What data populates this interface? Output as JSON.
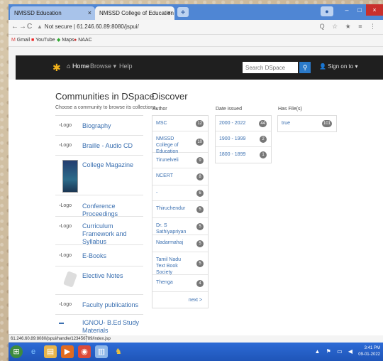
{
  "browser": {
    "tabs": [
      {
        "label": "NMSSD Education"
      },
      {
        "label": "NMSSD College of Education Pr"
      }
    ],
    "address": "Not secure | 61.246.60.89:8080/jspui/",
    "bookmarks": [
      "Gmail",
      "YouTube",
      "Maps",
      "NAAC"
    ]
  },
  "navbar": {
    "home": "Home",
    "browse": "Browse",
    "help": "Help",
    "search_placeholder": "Search DSpace",
    "login": "Sign on to"
  },
  "communities": {
    "title": "Communities in DSpace",
    "subtitle": "Choose a community to browse its collections.",
    "items": [
      {
        "logo": "Logo",
        "name": "Biography"
      },
      {
        "logo": "Logo",
        "name": "Braille - Audio CD"
      },
      {
        "logo": "",
        "name": "College Magazine"
      },
      {
        "logo": "Logo",
        "name": "Conference Proceedings"
      },
      {
        "logo": "Logo",
        "name": "Curriculum Framework and Syllabus"
      },
      {
        "logo": "Logo",
        "name": "E-Books"
      },
      {
        "logo": "",
        "name": "Elective Notes"
      },
      {
        "logo": "Logo",
        "name": "Faculty publications"
      },
      {
        "logo": "",
        "name": "IGNOU- B.Ed Study Materials"
      }
    ]
  },
  "discover": {
    "title": "Discover",
    "author": {
      "label": "Author",
      "items": [
        {
          "name": "MSC",
          "count": "12"
        },
        {
          "name": "NMSSD College of Education",
          "count": "10"
        },
        {
          "name": "Tirunelveli",
          "count": "9"
        },
        {
          "name": "NCERT",
          "count": "8"
        },
        {
          "name": "-",
          "count": "6"
        },
        {
          "name": "Thiruchendur",
          "count": "5"
        },
        {
          "name": "Dr. S Sathiyapriyan",
          "count": "5"
        },
        {
          "name": "Nadarmahaj",
          "count": "5"
        },
        {
          "name": "Tamil Nadu Text Book Society",
          "count": "5"
        },
        {
          "name": "Thenga",
          "count": "4"
        }
      ],
      "more": "next >"
    },
    "date": {
      "label": "Date issued",
      "items": [
        {
          "name": "2000 - 2022",
          "count": "44"
        },
        {
          "name": "1900 - 1999",
          "count": "2"
        },
        {
          "name": "1800 - 1899",
          "count": "1"
        }
      ]
    },
    "has_files": {
      "label": "Has File(s)",
      "items": [
        {
          "name": "true",
          "count": "101"
        }
      ]
    }
  },
  "status_url": "61.246.60.89:8080/jspui/handle/123456789/index.jsp",
  "clock": {
    "time": "3:41 PM",
    "date": "09-01-2022"
  }
}
